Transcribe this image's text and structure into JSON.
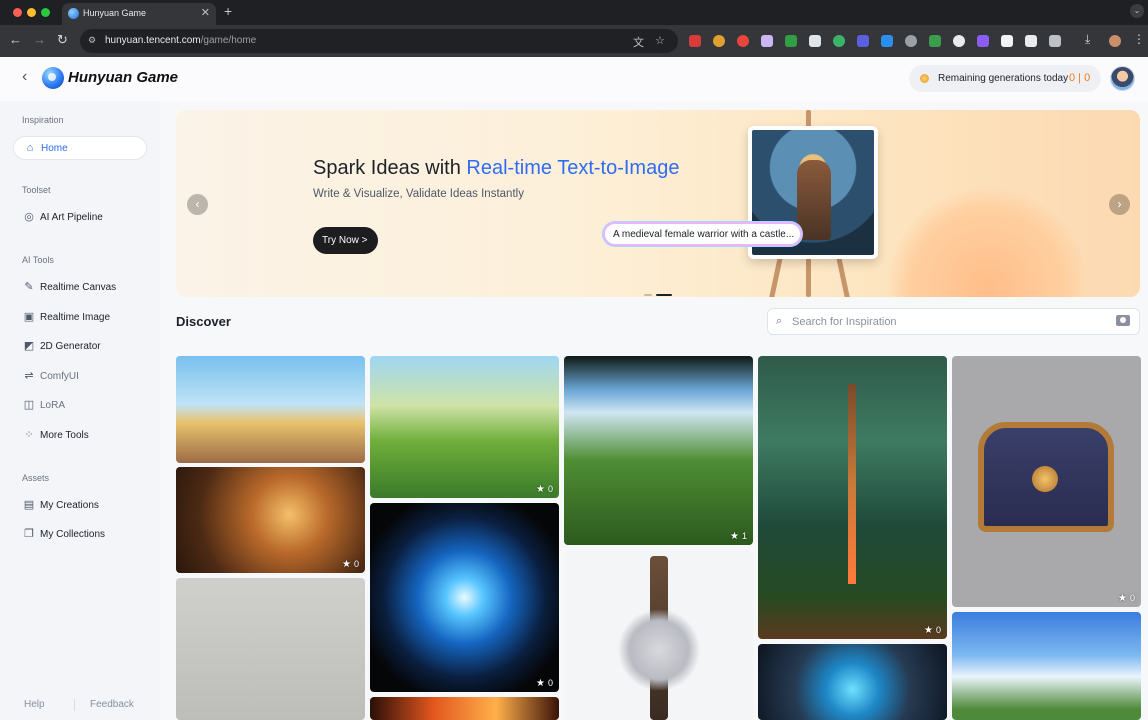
{
  "browser": {
    "tab_title": "Hunyuan Game",
    "url_host": "hunyuan.tencent.com",
    "url_path": "/game/home"
  },
  "header": {
    "logo_text": "Hunyuan Game",
    "generations_label": "Remaining generations today",
    "generations_count": "0 | 0"
  },
  "sidebar": {
    "sections": [
      {
        "title": "Inspiration",
        "items": [
          {
            "label": "Home",
            "icon": "home-icon",
            "active": true
          }
        ]
      },
      {
        "title": "Toolset",
        "items": [
          {
            "label": "AI Art Pipeline",
            "icon": "pipeline-icon"
          }
        ]
      },
      {
        "title": "AI Tools",
        "items": [
          {
            "label": "Realtime Canvas",
            "icon": "canvas-icon"
          },
          {
            "label": "Realtime Image",
            "icon": "image-icon"
          },
          {
            "label": "2D Generator",
            "icon": "generator-icon"
          },
          {
            "label": "ComfyUI",
            "icon": "comfyui-icon",
            "muted": true
          },
          {
            "label": "LoRA",
            "icon": "lora-icon",
            "muted": true
          },
          {
            "label": "More Tools",
            "icon": "grid-icon"
          }
        ]
      },
      {
        "title": "Assets",
        "items": [
          {
            "label": "My Creations",
            "icon": "creations-icon"
          },
          {
            "label": "My Collections",
            "icon": "collections-icon"
          }
        ]
      }
    ],
    "footer": {
      "help": "Help",
      "feedback": "Feedback"
    }
  },
  "banner": {
    "title_plain": "Spark Ideas with ",
    "title_highlight": "Real-time Text-to-Image",
    "subtitle": "Write & Visualize, Validate Ideas Instantly",
    "cta": "Try Now >",
    "prompt": "A medieval female warrior with a castle...",
    "prev_icon": "chevron-left-icon",
    "next_icon": "chevron-right-icon"
  },
  "discover": {
    "title": "Discover",
    "search_placeholder": "Search for Inspiration",
    "cards": [
      {
        "name": "village-street",
        "favorites": ""
      },
      {
        "name": "mushroom-house",
        "favorites": "0"
      },
      {
        "name": "forest-meadow",
        "favorites": "1"
      },
      {
        "name": "forest-sword",
        "favorites": "0"
      },
      {
        "name": "treasure-chest",
        "favorites": "0"
      },
      {
        "name": "golden-hall",
        "favorites": "0"
      },
      {
        "name": "blue-vortex",
        "favorites": "0"
      },
      {
        "name": "ornate-sword",
        "favorites": ""
      },
      {
        "name": "game-props",
        "favorites": ""
      },
      {
        "name": "fire-strip",
        "favorites": ""
      },
      {
        "name": "blue-demon",
        "favorites": ""
      },
      {
        "name": "sky-streetlamp",
        "favorites": ""
      }
    ]
  },
  "colors": {
    "accent": "#2f6bf3",
    "counter": "#f07b1f",
    "sidebar_bg": "#f3f5f9"
  }
}
